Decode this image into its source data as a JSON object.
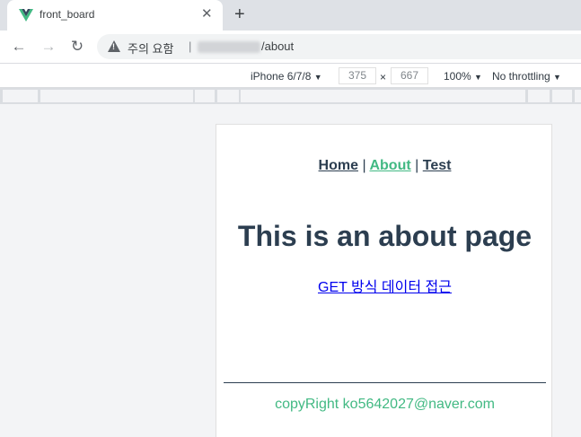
{
  "browser": {
    "tab_title": "front_board",
    "tab_close_glyph": "✕",
    "new_tab_glyph": "+",
    "back_glyph": "←",
    "forward_glyph": "→",
    "reload_glyph": "↻",
    "security_warning": "주의 요함",
    "separator": "|",
    "url_path": "/about"
  },
  "device_toolbar": {
    "device_name": "iPhone 6/7/8",
    "width": "375",
    "times": "×",
    "height": "667",
    "zoom": "100%",
    "throttling": "No throttling",
    "dropdown_glyph": "▼"
  },
  "page": {
    "nav": {
      "home": "Home",
      "about": "About",
      "test": "Test",
      "pipe": "|"
    },
    "title": "This is an about page",
    "get_link": "GET 방식 데이터 접근",
    "footer": "copyRight ko5642027@naver.com"
  },
  "colors": {
    "accent": "#42b983",
    "text": "#2c3e50",
    "link": "#0000ee"
  },
  "icons": {
    "favicon": "vue-logo-icon",
    "security": "warning-triangle-icon"
  }
}
